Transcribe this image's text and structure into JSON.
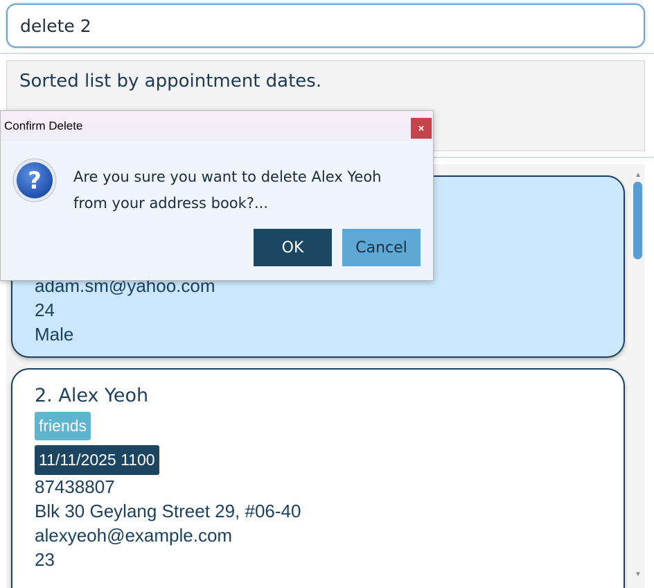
{
  "command": {
    "value": "delete 2"
  },
  "result": {
    "text": "Sorted list by appointment dates."
  },
  "persons": [
    {
      "visible_lines": [
        "adam.sm@yahoo.com",
        "24",
        "Male"
      ]
    },
    {
      "name": "2. Alex Yeoh",
      "tag": "friends",
      "appointment": "11/11/2025 1100",
      "phone": "87438807",
      "address": "Blk 30 Geylang Street 29, #06-40",
      "email": "alexyeoh@example.com",
      "age": "23"
    }
  ],
  "dialog": {
    "title": "Confirm Delete",
    "close_label": "×",
    "message_line1": "Are you sure you want to delete Alex Yeoh",
    "message_line2": "from your address book?...",
    "ok_label": "OK",
    "cancel_label": "Cancel"
  },
  "scrollbar": {
    "up_arrow": "▲",
    "down_arrow": "▼"
  },
  "colors": {
    "primary": "#1c4762",
    "selected_card": "#cce7fb",
    "tag": "#5fb5cd",
    "cancel": "#5fa8d6",
    "close": "#c5444b"
  },
  "icons": {
    "dialog": "question-icon"
  }
}
